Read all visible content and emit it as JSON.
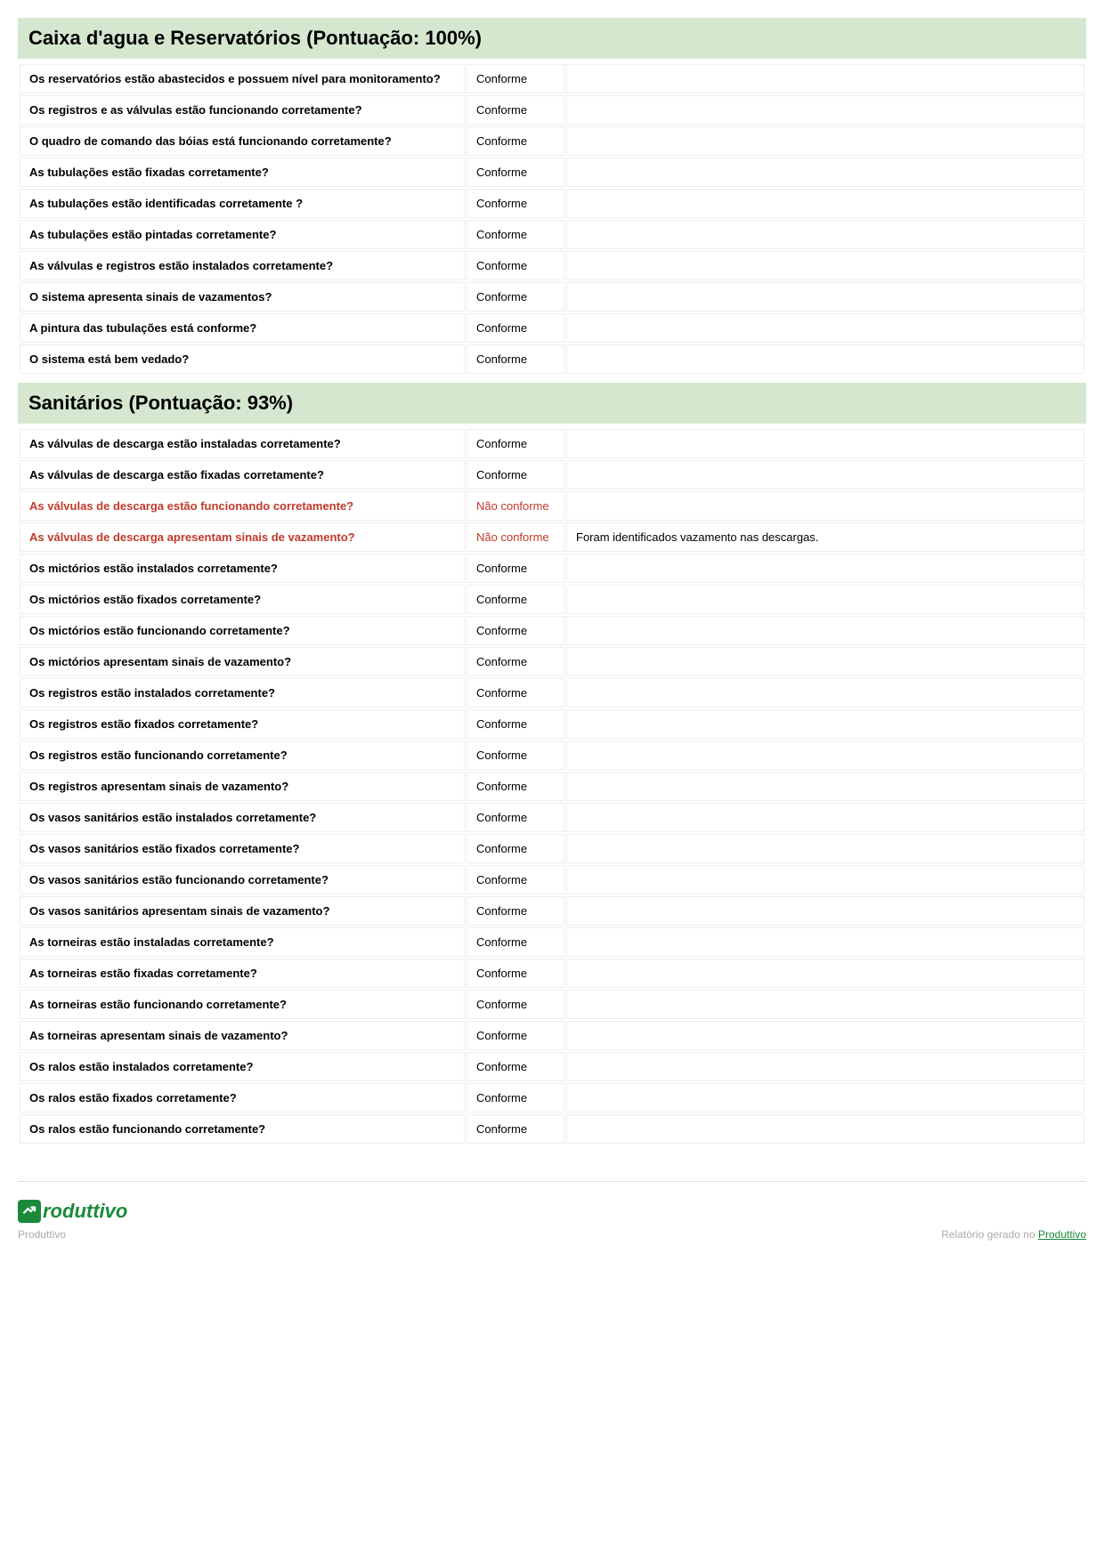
{
  "sections": [
    {
      "title": "Caixa d'agua e Reservatórios (Pontuação: 100%)",
      "rows": [
        {
          "q": "Os reservatórios estão abastecidos e possuem nível para monitoramento?",
          "status": "Conforme",
          "note": "",
          "nc": false
        },
        {
          "q": "Os registros e as válvulas estão funcionando corretamente?",
          "status": "Conforme",
          "note": "",
          "nc": false
        },
        {
          "q": "O quadro de comando das bóias está funcionando corretamente?",
          "status": "Conforme",
          "note": "",
          "nc": false
        },
        {
          "q": "As tubulações estão fixadas corretamente?",
          "status": "Conforme",
          "note": "",
          "nc": false
        },
        {
          "q": "As tubulações estão identificadas corretamente ?",
          "status": "Conforme",
          "note": "",
          "nc": false
        },
        {
          "q": "As tubulações estão pintadas corretamente?",
          "status": "Conforme",
          "note": "",
          "nc": false
        },
        {
          "q": "As válvulas e registros estão instalados corretamente?",
          "status": "Conforme",
          "note": "",
          "nc": false
        },
        {
          "q": "O sistema apresenta sinais de vazamentos?",
          "status": "Conforme",
          "note": "",
          "nc": false
        },
        {
          "q": "A pintura das tubulações está conforme?",
          "status": "Conforme",
          "note": "",
          "nc": false
        },
        {
          "q": "O sistema está bem vedado?",
          "status": "Conforme",
          "note": "",
          "nc": false
        }
      ]
    },
    {
      "title": "Sanitários (Pontuação: 93%)",
      "rows": [
        {
          "q": "As válvulas de descarga estão instaladas corretamente?",
          "status": "Conforme",
          "note": "",
          "nc": false
        },
        {
          "q": "As válvulas de descarga estão fixadas corretamente?",
          "status": "Conforme",
          "note": "",
          "nc": false
        },
        {
          "q": "As válvulas de descarga estão funcionando corretamente?",
          "status": "Não conforme",
          "note": "",
          "nc": true
        },
        {
          "q": "As válvulas de descarga apresentam sinais de vazamento?",
          "status": "Não conforme",
          "note": "Foram identificados vazamento nas descargas.",
          "nc": true
        },
        {
          "q": "Os mictórios estão instalados corretamente?",
          "status": "Conforme",
          "note": "",
          "nc": false
        },
        {
          "q": "Os mictórios estão fixados corretamente?",
          "status": "Conforme",
          "note": "",
          "nc": false
        },
        {
          "q": "Os mictórios estão funcionando corretamente?",
          "status": "Conforme",
          "note": "",
          "nc": false
        },
        {
          "q": "Os mictórios apresentam sinais de vazamento?",
          "status": "Conforme",
          "note": "",
          "nc": false
        },
        {
          "q": "Os registros estão instalados corretamente?",
          "status": "Conforme",
          "note": "",
          "nc": false
        },
        {
          "q": "Os registros estão fixados corretamente?",
          "status": "Conforme",
          "note": "",
          "nc": false
        },
        {
          "q": "Os registros estão funcionando corretamente?",
          "status": "Conforme",
          "note": "",
          "nc": false
        },
        {
          "q": "Os registros apresentam sinais de vazamento?",
          "status": "Conforme",
          "note": "",
          "nc": false
        },
        {
          "q": "Os vasos sanitários estão instalados corretamente?",
          "status": "Conforme",
          "note": "",
          "nc": false
        },
        {
          "q": "Os vasos sanitários estão fixados corretamente?",
          "status": "Conforme",
          "note": "",
          "nc": false
        },
        {
          "q": "Os vasos sanitários estão funcionando corretamente?",
          "status": "Conforme",
          "note": "",
          "nc": false
        },
        {
          "q": "Os vasos sanitários apresentam sinais de vazamento?",
          "status": "Conforme",
          "note": "",
          "nc": false
        },
        {
          "q": "As torneiras estão instaladas corretamente?",
          "status": "Conforme",
          "note": "",
          "nc": false
        },
        {
          "q": "As torneiras estão fixadas corretamente?",
          "status": "Conforme",
          "note": "",
          "nc": false
        },
        {
          "q": "As torneiras estão funcionando corretamente?",
          "status": "Conforme",
          "note": "",
          "nc": false
        },
        {
          "q": "As torneiras apresentam sinais de vazamento?",
          "status": "Conforme",
          "note": "",
          "nc": false
        },
        {
          "q": "Os ralos estão instalados corretamente?",
          "status": "Conforme",
          "note": "",
          "nc": false
        },
        {
          "q": "Os ralos estão fixados corretamente?",
          "status": "Conforme",
          "note": "",
          "nc": false
        },
        {
          "q": "Os ralos estão funcionando corretamente?",
          "status": "Conforme",
          "note": "",
          "nc": false
        }
      ]
    }
  ],
  "footer": {
    "brand": "roduttivo",
    "brandline": "Produttivo",
    "report_text": "Relatório gerado no ",
    "report_link": "Produttivo"
  }
}
